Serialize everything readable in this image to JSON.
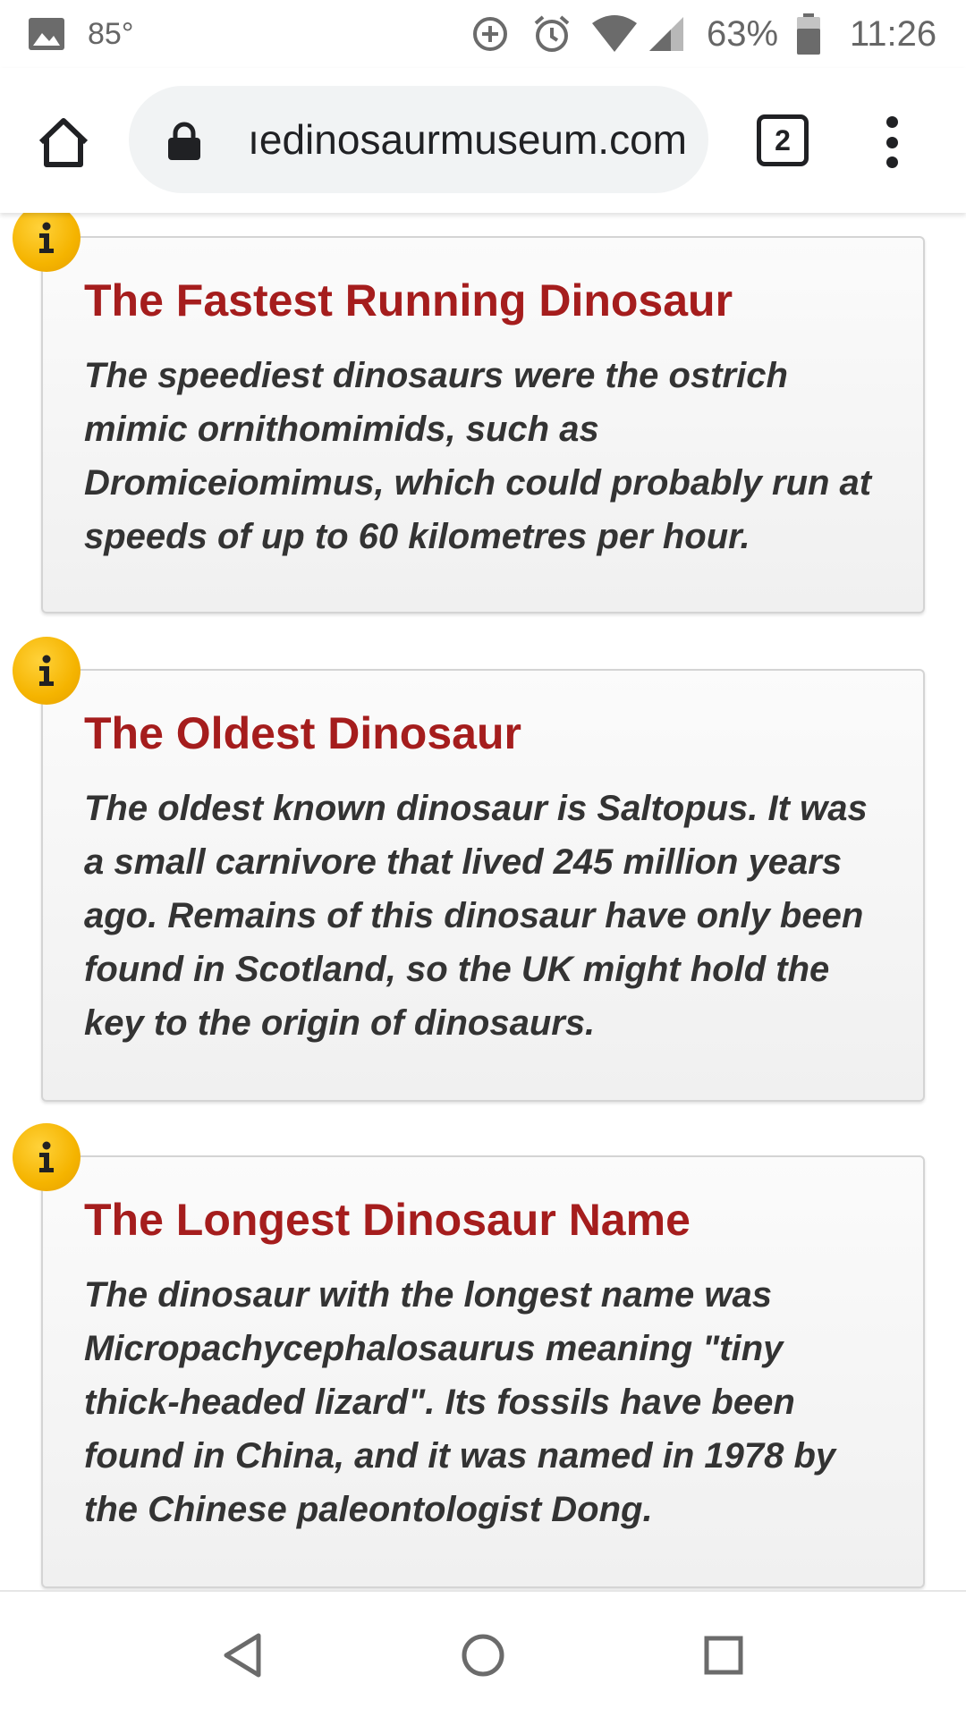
{
  "status_bar": {
    "temperature": "85°",
    "battery": "63%",
    "time": "11:26",
    "icons": [
      "image-icon",
      "data-saver-icon",
      "alarm-icon",
      "wifi-icon",
      "signal-icon",
      "battery-icon"
    ]
  },
  "browser": {
    "url": "ıedinosaurmuseum.com",
    "tab_count": "2",
    "icons": [
      "home-icon",
      "lock-icon",
      "tabs-icon",
      "more-vert-icon"
    ]
  },
  "facts": [
    {
      "title": "The Fastest Running Dinosaur",
      "body": "The speediest dinosaurs were the ostrich mimic ornithomimids, such as Dromiceiomimus, which could probably run at speeds of up to 60 kilometres per hour."
    },
    {
      "title": "The Oldest Dinosaur",
      "body": "The oldest known dinosaur is Saltopus. It was a small carnivore that lived 245 million years ago. Remains of this dinosaur have only been found in Scotland, so the UK might hold the key to the origin of dinosaurs."
    },
    {
      "title": "The Longest Dinosaur Name",
      "body": "The dinosaur with the longest name was Micropachycephalosaurus meaning \"tiny thick-headed lizard\". Its fossils have been found in China, and it was named in 1978 by the Chinese paleontologist Dong."
    }
  ],
  "info_icon": "i",
  "colors": {
    "title_red": "#a51d1d",
    "badge_yellow": "#f5b400",
    "body_text": "#333333"
  },
  "nav_bar": {
    "icons": [
      "back-icon",
      "home-circle-icon",
      "recents-icon"
    ]
  }
}
